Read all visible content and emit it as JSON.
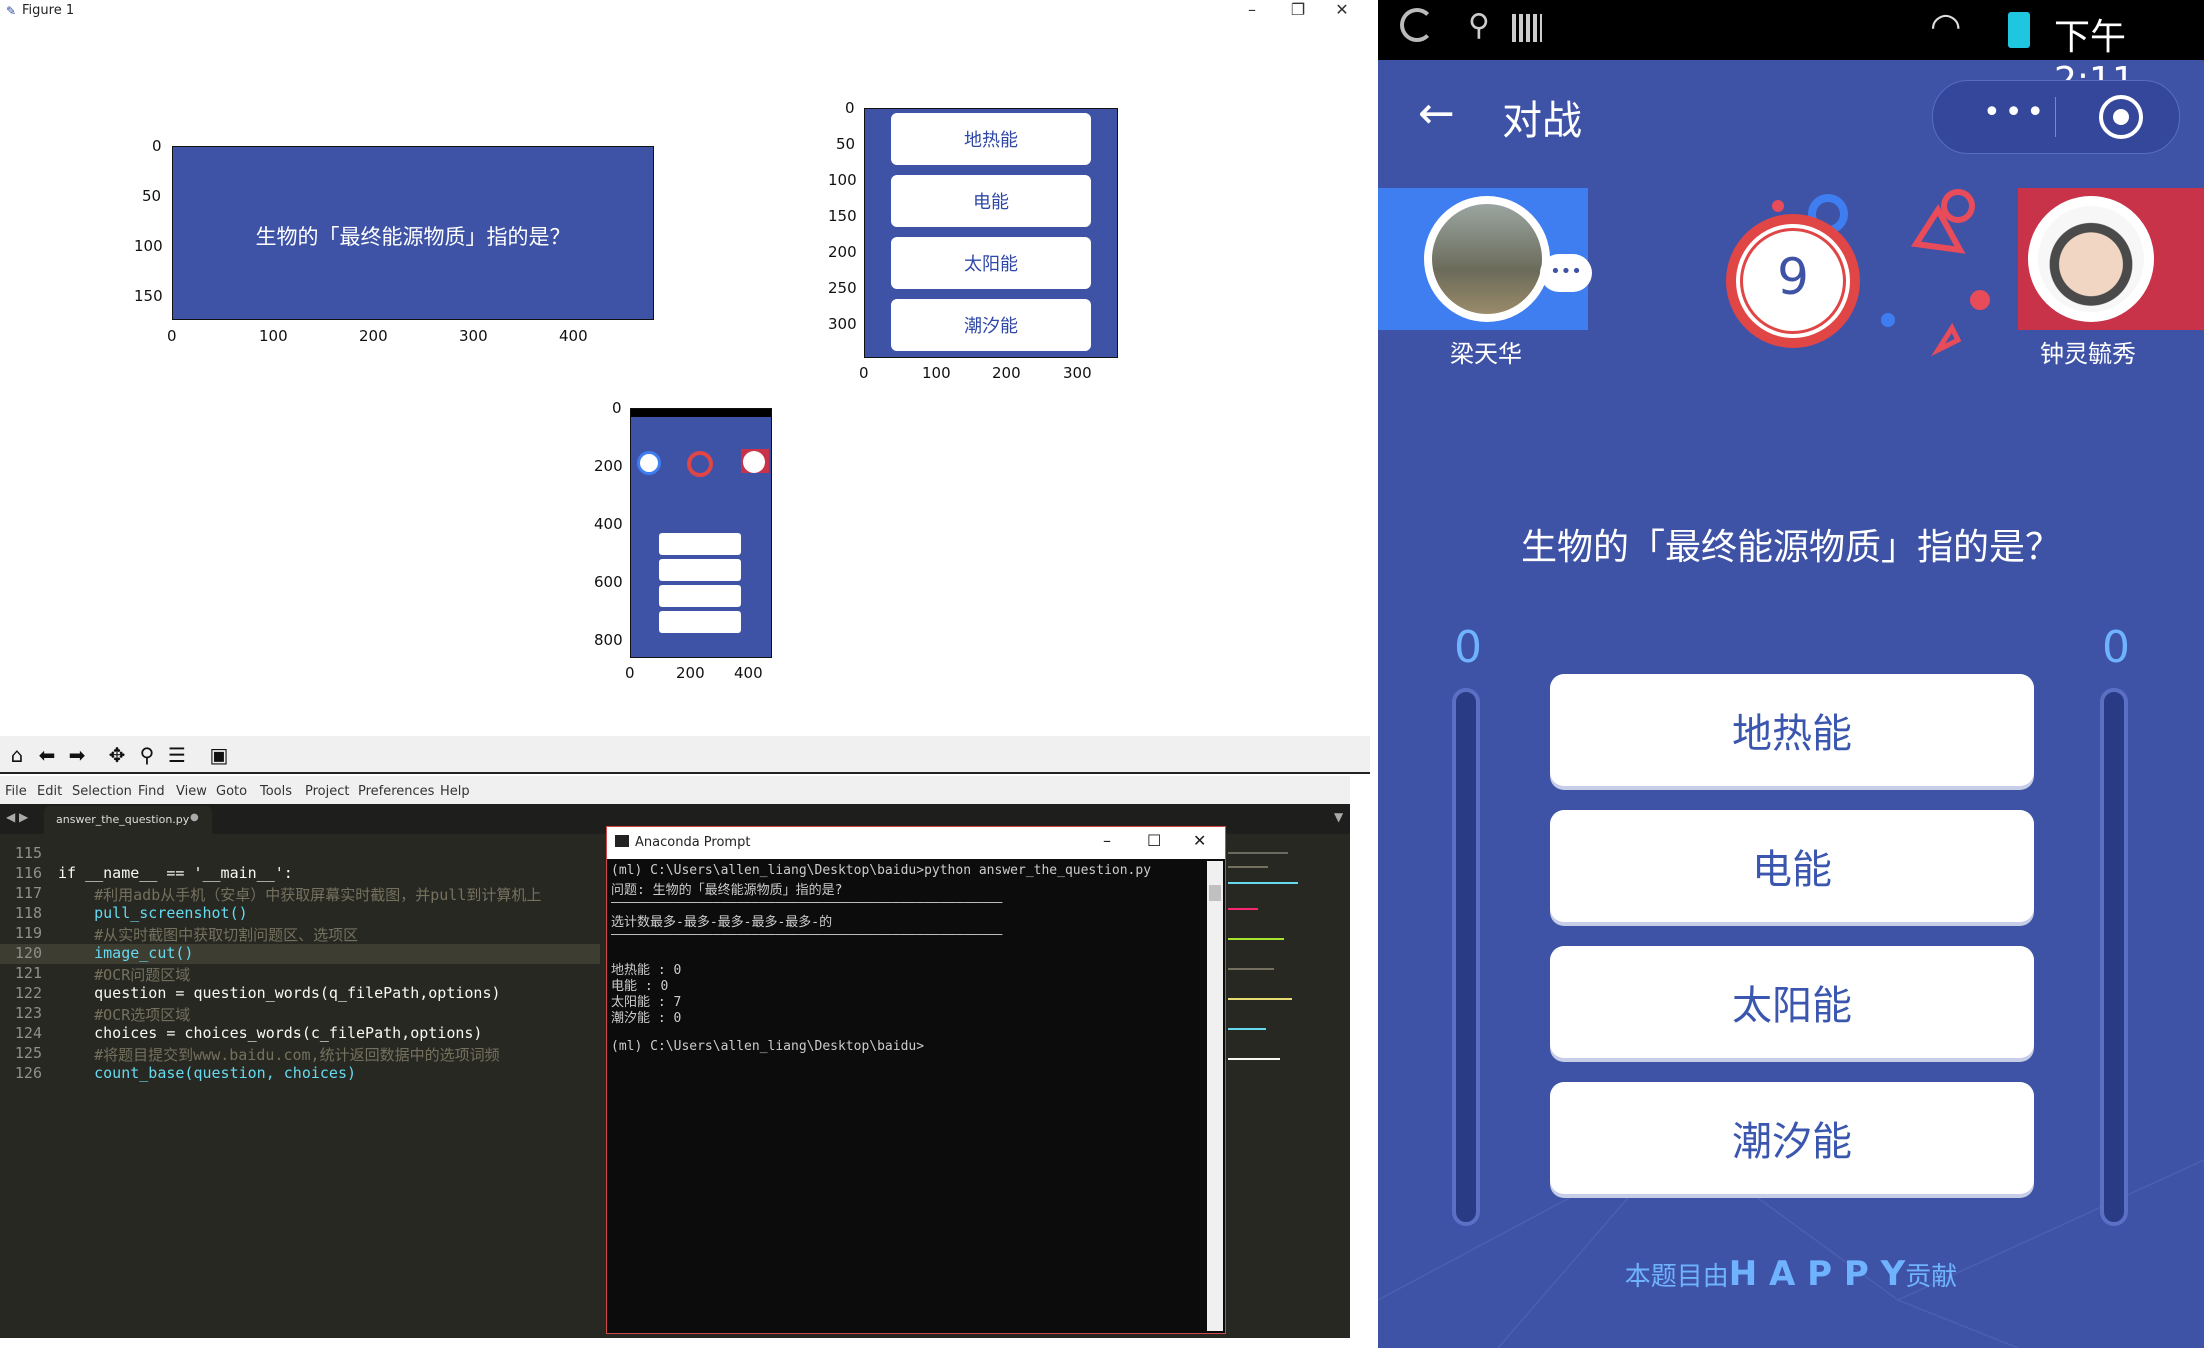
{
  "figure_window": {
    "title": "Figure 1",
    "controls": [
      "–",
      "❐",
      "✕"
    ]
  },
  "plot_question": {
    "text": "生物的「最终能源物质」指的是？",
    "y_ticks": [
      "0",
      "50",
      "100",
      "150"
    ],
    "x_ticks": [
      "0",
      "100",
      "200",
      "300",
      "400"
    ]
  },
  "plot_choices": {
    "items": [
      "地热能",
      "电能",
      "太阳能",
      "潮汐能"
    ],
    "y_ticks": [
      "0",
      "50",
      "100",
      "150",
      "200",
      "250",
      "300"
    ],
    "x_ticks": [
      "0",
      "100",
      "200",
      "300"
    ]
  },
  "plot_screenshot": {
    "y_ticks": [
      "0",
      "200",
      "400",
      "600",
      "800"
    ],
    "x_ticks": [
      "0",
      "200",
      "400"
    ]
  },
  "toolbar": {
    "icons": [
      "home-icon",
      "back-arrow-icon",
      "forward-arrow-icon",
      "pan-icon",
      "zoom-icon",
      "configure-icon",
      "save-icon"
    ]
  },
  "editor": {
    "menu": [
      "File",
      "Edit",
      "Selection",
      "Find",
      "View",
      "Goto",
      "Tools",
      "Project",
      "Preferences",
      "Help"
    ],
    "tab": "answer_the_question.py",
    "lines": [
      {
        "n": "115",
        "t": ""
      },
      {
        "n": "116",
        "t": "if __name__ == '__main__':"
      },
      {
        "n": "117",
        "t": "    #利用adb从手机（安卓）中获取屏幕实时截图，并pull到计算机上"
      },
      {
        "n": "118",
        "t": "    pull_screenshot()"
      },
      {
        "n": "119",
        "t": "    #从实时截图中获取切割问题区、选项区"
      },
      {
        "n": "120",
        "t": "    image_cut()"
      },
      {
        "n": "121",
        "t": "    #OCR问题区域"
      },
      {
        "n": "122",
        "t": "    question = question_words(q_filePath,options)"
      },
      {
        "n": "123",
        "t": "    #OCR选项区域"
      },
      {
        "n": "124",
        "t": "    choices = choices_words(c_filePath,options)"
      },
      {
        "n": "125",
        "t": "    #将题目提交到www.baidu.com,统计返回数据中的选项词频"
      },
      {
        "n": "126",
        "t": "    count_base(question, choices)"
      }
    ]
  },
  "anaconda": {
    "title": "Anaconda Prompt",
    "lines": [
      "(ml) C:\\Users\\allen_liang\\Desktop\\baidu>python answer_the_question.py",
      "问题: 生物的「最终能源物质」指的是?",
      "——————————————————————————————————————————————————",
      "选计数最多-最多-最多-最多-最多-的",
      "——————————————————————————————————————————————————",
      "",
      "地热能 : 0",
      "电能 : 0",
      "太阳能 : 7",
      "潮汐能 : 0",
      "",
      "(ml) C:\\Users\\allen_liang\\Desktop\\baidu>"
    ]
  },
  "phone": {
    "status_time": "下午2:11",
    "nav_title": "对战",
    "player_left": "梁天华",
    "player_right": "钟灵毓秀",
    "timer": "9",
    "question": "生物的「最终能源物质」指的是？",
    "score_left": "0",
    "score_right": "0",
    "choices": [
      "地热能",
      "电能",
      "太阳能",
      "潮汐能"
    ],
    "footer_prefix": "本题目由",
    "footer_name": "H A P P Y",
    "footer_suffix": "贡献",
    "accent_left": "#3f7ef0",
    "accent_right": "#c8334a"
  }
}
